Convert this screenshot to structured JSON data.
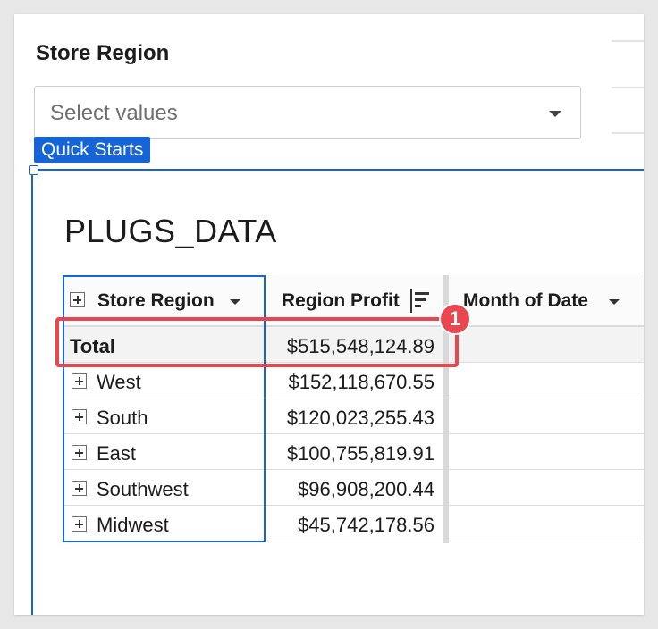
{
  "filter": {
    "label": "Store Region",
    "placeholder": "Select values"
  },
  "quick_starts_label": "Quick Starts",
  "table": {
    "title": "PLUGS_DATA",
    "headers": {
      "store_region": "Store Region",
      "region_profit": "Region Profit",
      "month_of_date": "Month of Date"
    },
    "total": {
      "label": "Total",
      "value": "$515,548,124.89"
    },
    "rows": [
      {
        "region": "West",
        "profit": "$152,118,670.55"
      },
      {
        "region": "South",
        "profit": "$120,023,255.43"
      },
      {
        "region": "East",
        "profit": "$100,755,819.91"
      },
      {
        "region": "Southwest",
        "profit": "$96,908,200.44"
      },
      {
        "region": "Midwest",
        "profit": "$45,742,178.56"
      }
    ]
  },
  "annotation": {
    "badge_number": "1"
  },
  "colors": {
    "selection_blue": "#1565d8",
    "annotation_red": "#e8474f"
  }
}
